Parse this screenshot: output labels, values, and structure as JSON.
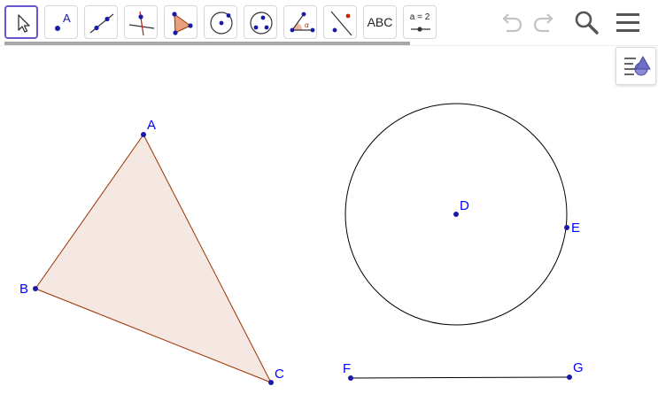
{
  "toolbar": {
    "tools": [
      {
        "name": "move",
        "icon": "arrow-cursor-icon",
        "selected": true
      },
      {
        "name": "point",
        "icon": "point-icon",
        "icon_label": "A"
      },
      {
        "name": "line",
        "icon": "line-through-two-points-icon"
      },
      {
        "name": "perpendicular-line",
        "icon": "perpendicular-line-icon"
      },
      {
        "name": "polygon",
        "icon": "polygon-icon"
      },
      {
        "name": "circle-center-point",
        "icon": "circle-center-point-icon"
      },
      {
        "name": "circle-three-points",
        "icon": "circle-three-points-icon"
      },
      {
        "name": "angle",
        "icon": "angle-icon",
        "icon_label": "α"
      },
      {
        "name": "reflect",
        "icon": "reflect-about-line-icon"
      },
      {
        "name": "text",
        "icon": "text-icon",
        "label": "ABC"
      },
      {
        "name": "slider",
        "icon": "slider-icon",
        "label": "a = 2"
      }
    ],
    "right": [
      "undo-icon",
      "redo-icon",
      "search-icon",
      "menu-icon"
    ]
  },
  "algebra_toggle": {
    "icon": "algebra-view-icon"
  },
  "graphics": {
    "colors": {
      "point": "#1a1aa8",
      "label": "#0000ff",
      "polygon_edge": "#993300",
      "polygon_fill": "#f5e7e2",
      "circle": "#000000",
      "segment": "#000000"
    },
    "points": [
      {
        "id": "A",
        "label": "A"
      },
      {
        "id": "B",
        "label": "B"
      },
      {
        "id": "C",
        "label": "C"
      },
      {
        "id": "D",
        "label": "D"
      },
      {
        "id": "E",
        "label": "E"
      },
      {
        "id": "F",
        "label": "F"
      },
      {
        "id": "G",
        "label": "G"
      }
    ],
    "polygon": {
      "vertices": [
        "A",
        "B",
        "C"
      ]
    },
    "circle": {
      "center": "D",
      "through": "E"
    },
    "segment": {
      "from": "F",
      "to": "G"
    }
  }
}
